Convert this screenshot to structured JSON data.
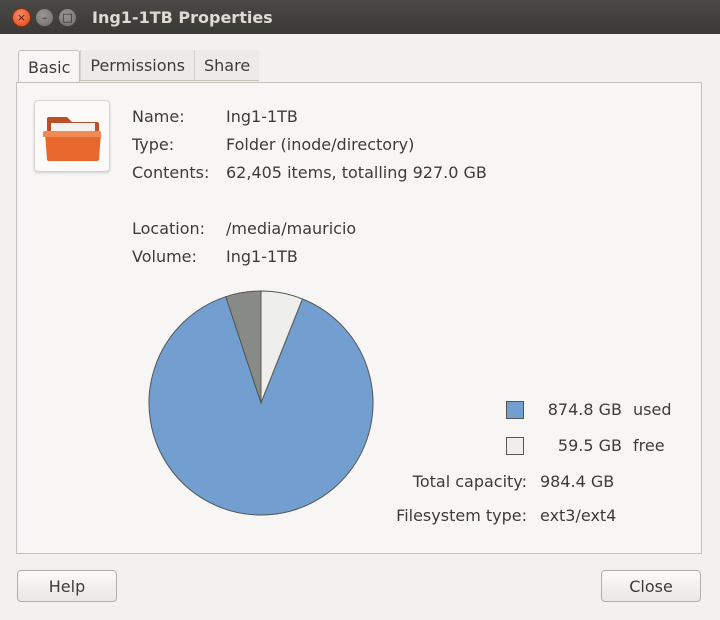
{
  "window": {
    "title": "Ing1-1TB Properties",
    "close_glyph": "×",
    "min_glyph": "–",
    "max_glyph": "□"
  },
  "tabs": [
    {
      "label": "Basic",
      "active": true
    },
    {
      "label": "Permissions",
      "active": false
    },
    {
      "label": "Share",
      "active": false
    }
  ],
  "info": {
    "name_label": "Name:",
    "name_value": "Ing1-1TB",
    "type_label": "Type:",
    "type_value": "Folder (inode/directory)",
    "contents_label": "Contents:",
    "contents_value": "62,405 items, totalling 927.0 GB",
    "location_label": "Location:",
    "location_value": "/media/mauricio",
    "volume_label": "Volume:",
    "volume_value": "Ing1-1TB"
  },
  "usage": {
    "used_value": "874.8 GB",
    "used_label": "used",
    "free_value": "59.5 GB",
    "free_label": "free",
    "total_label": "Total capacity:",
    "total_value": "984.4 GB",
    "fs_label": "Filesystem type:",
    "fs_value": "ext3/ext4",
    "used_color": "#729fcf",
    "free_color": "#eeeeec",
    "reserved_color": "#888a85"
  },
  "chart_data": {
    "type": "pie",
    "categories": [
      "used",
      "free",
      "other"
    ],
    "values": [
      874.8,
      59.5,
      50.1
    ]
  },
  "buttons": {
    "help_label": "Help",
    "close_label": "Close"
  },
  "icons": {
    "folder": "folder-icon"
  }
}
